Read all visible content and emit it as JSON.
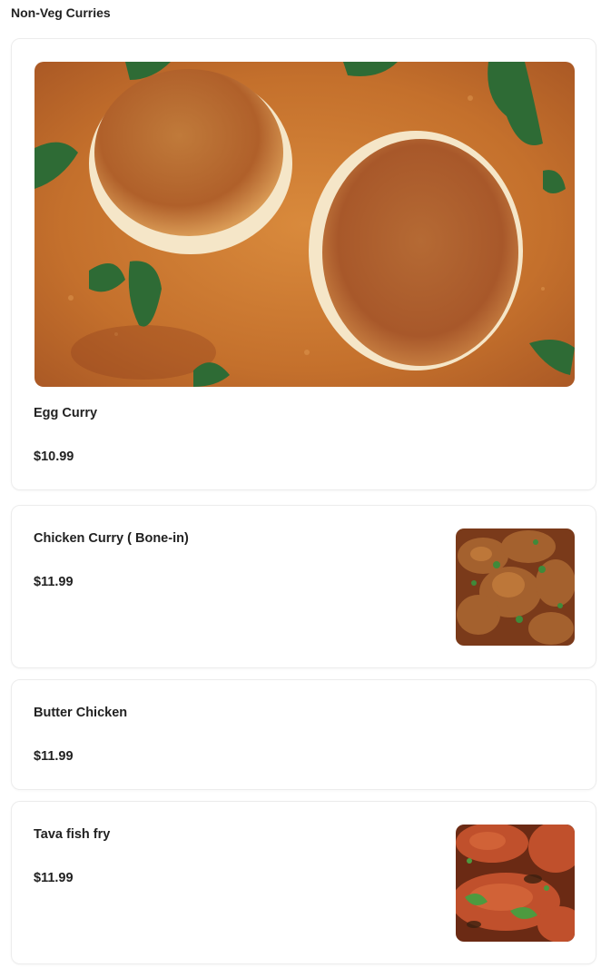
{
  "section": {
    "title": "Non-Veg Curries"
  },
  "items": [
    {
      "name": "Egg Curry",
      "price": "$10.99",
      "image": "egg-curry-photo"
    },
    {
      "name": "Chicken Curry ( Bone-in)",
      "price": "$11.99",
      "image": "chicken-curry-photo"
    },
    {
      "name": "Butter Chicken",
      "price": "$11.99"
    },
    {
      "name": "Tava fish fry",
      "price": "$11.99",
      "image": "tava-fish-fry-photo"
    }
  ],
  "colors": {
    "card_border": "#ececec",
    "text": "#222222",
    "curry_sauce": "#c8742e",
    "egg_crust": "#b8642a",
    "cilantro": "#2e6b35"
  }
}
